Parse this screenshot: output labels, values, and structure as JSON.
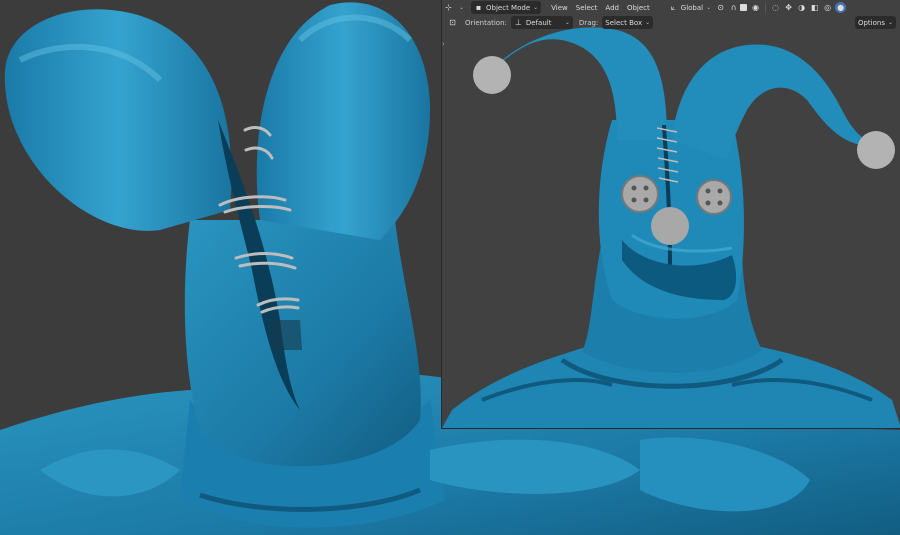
{
  "header": {
    "editor_type_icon": "view3d-icon",
    "mode_label": "Object Mode",
    "menus": [
      "View",
      "Select",
      "Add",
      "Object"
    ],
    "transform_orientation": "Global",
    "options_label": "Options"
  },
  "tool_settings": {
    "tool_icon": "select-box-icon",
    "orientation_label": "Orientation:",
    "orientation_value": "Default",
    "drag_label": "Drag:",
    "drag_value": "Select Box"
  },
  "icons": [
    "view3d-icon",
    "object-mode-icon",
    "transform-global-icon",
    "pivot-icon",
    "snap-icon",
    "proportional-edit-icon",
    "visibility-icon",
    "gizmo-icon",
    "overlay-icon",
    "xray-icon",
    "wireframe-shading-icon",
    "solid-shading-icon",
    "select-box-icon"
  ],
  "colors": {
    "model": "#1f86b3",
    "model_dark": "#0d4f70",
    "model_light": "#4fb0d6",
    "viewport_bg": "#3c3c3c",
    "header_button_bg": "#2b2b2b",
    "accent": "#4772b3",
    "sphere": "#b5b5b5"
  }
}
